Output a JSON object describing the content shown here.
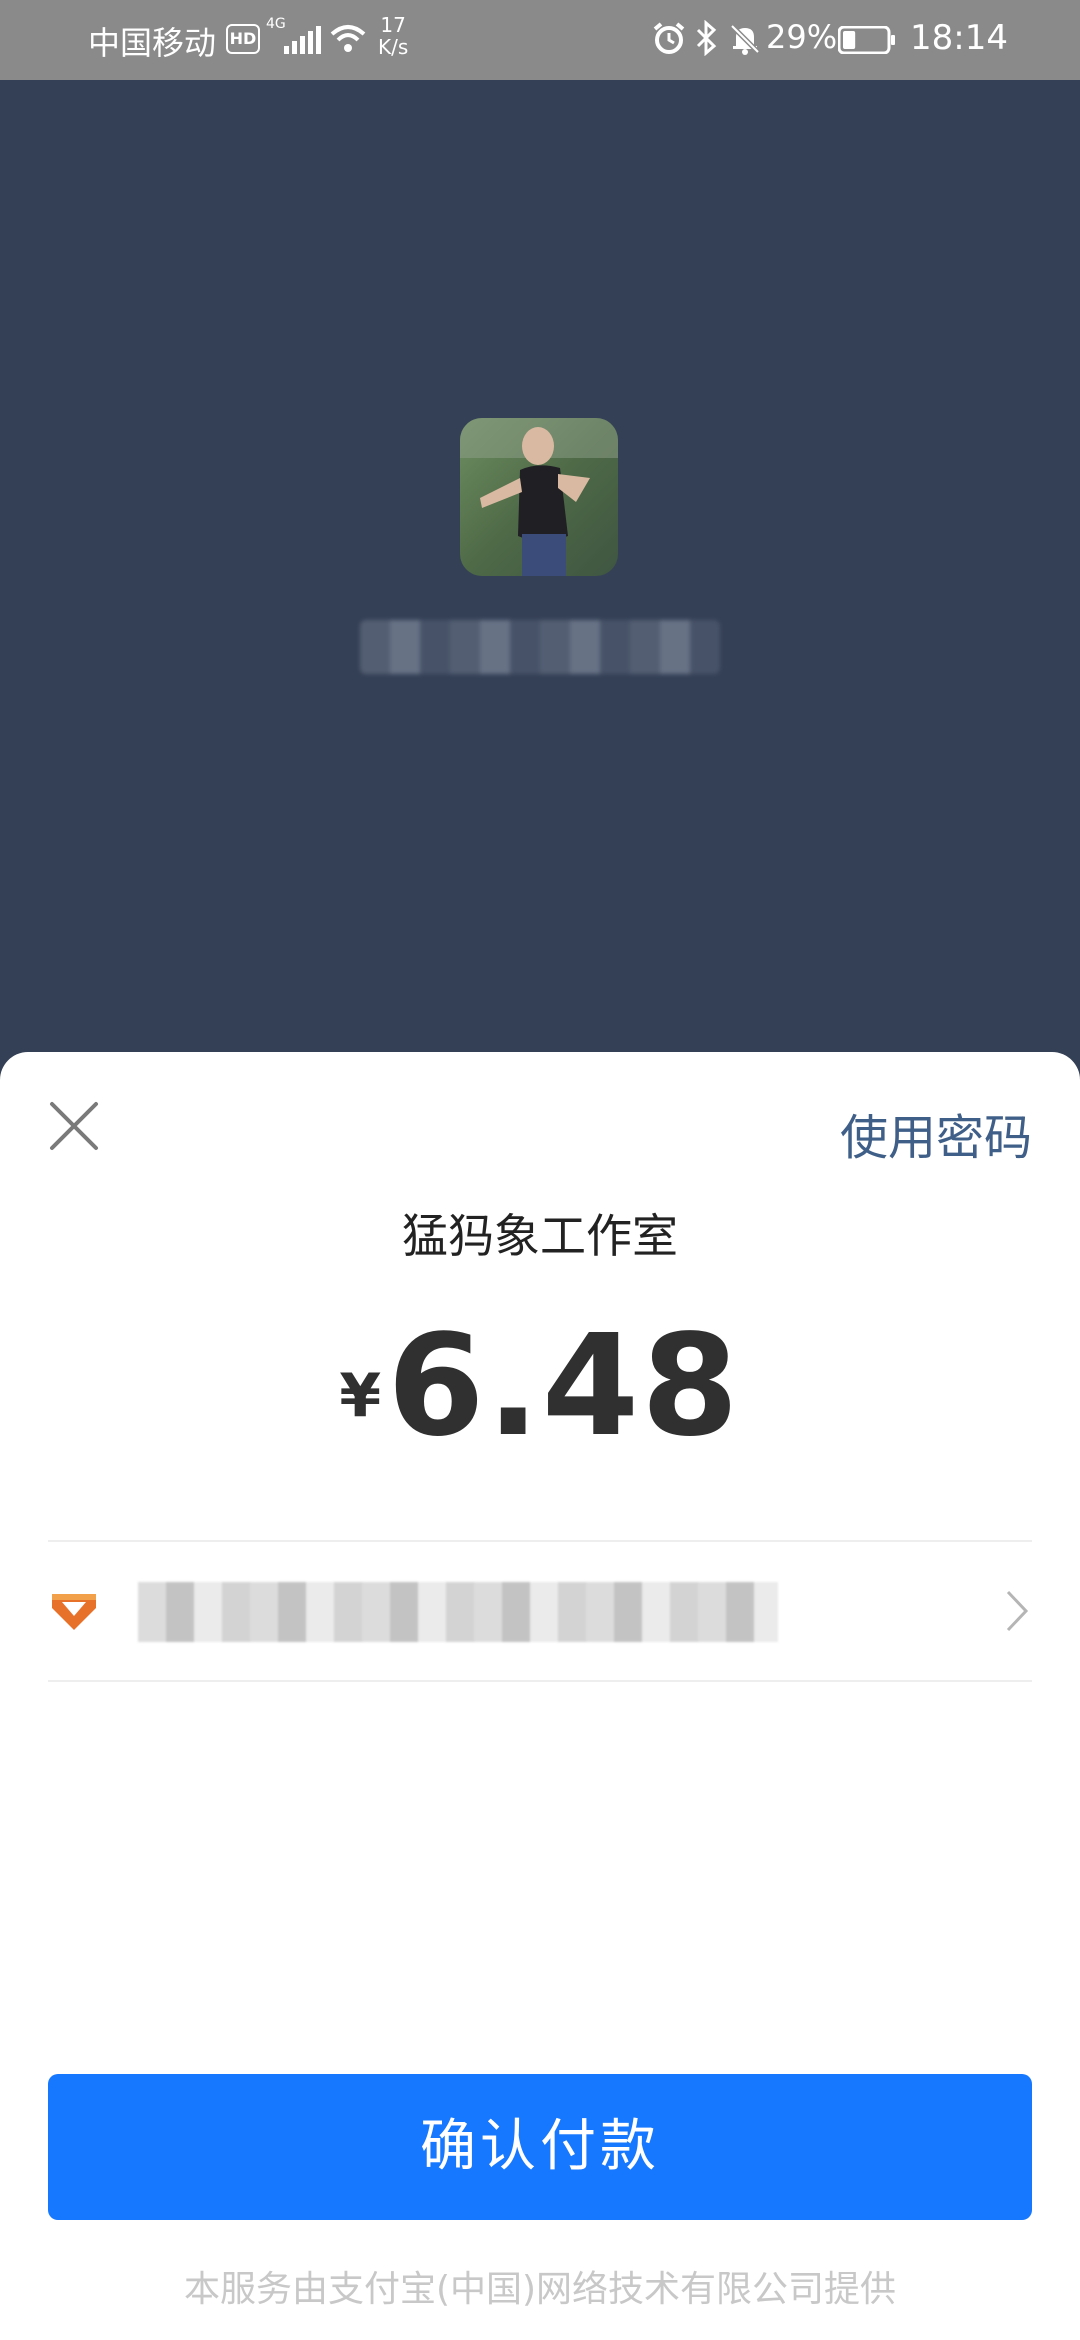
{
  "status_bar": {
    "carrier": "中国移动",
    "hd_label": "HD",
    "network_type": "4G",
    "speed_value": "17",
    "speed_unit": "K/s",
    "battery_percent": "29%",
    "battery_level": 0.29,
    "time": "18:14",
    "icons": [
      "hd-icon",
      "signal-icon",
      "wifi-icon",
      "alarm-icon",
      "bluetooth-icon",
      "mute-bell-icon",
      "battery-icon"
    ]
  },
  "sheet": {
    "use_password_label": "使用密码",
    "merchant_name": "猛犸象工作室",
    "currency_symbol": "¥",
    "amount": "6.48",
    "payment_method_icon": "bank-card-icon",
    "confirm_label": "确认付款",
    "footer_text": "本服务由支付宝(中国)网络技术有限公司提供"
  },
  "colors": {
    "background": "#344056",
    "primary_button": "#1677ff",
    "link": "#3f5f88",
    "status_bar": "#8a8a8a"
  }
}
